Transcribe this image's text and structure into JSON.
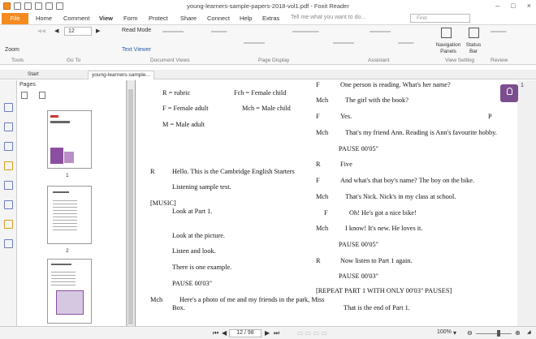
{
  "app": {
    "title": "young-learners-sample-papers-2018-vol1.pdf - Foxit Reader"
  },
  "menu": {
    "file": "File",
    "tabs": [
      "Home",
      "Comment",
      "View",
      "Form",
      "Protect",
      "Share",
      "Connect",
      "Help",
      "Extras"
    ],
    "tell_me": "Tell me what you want to do...",
    "find_placeholder": "Find"
  },
  "ribbon": {
    "zoom": "Zoom",
    "page_number": "12",
    "read_mode": "Read Mode",
    "text_viewer": "Text Viewer",
    "navigation_panels": "Navigation Panels",
    "status_bar": "Status Bar",
    "groups": [
      "Tools",
      "Go To",
      "Document Views",
      "Page Display",
      "Assistant",
      "View Setting",
      "Review"
    ]
  },
  "doc_tabs": {
    "start": "Start",
    "doc": "young-learners-sample..."
  },
  "pages_panel": {
    "title": "Pages",
    "thumbs": [
      "1",
      "2"
    ]
  },
  "document": {
    "left": [
      "R = rubric",
      "Fch = Female child",
      "F = Female adult",
      "Mch = Male child",
      "M = Male adult",
      "R",
      "Hello. This is the Cambridge English Starters",
      "Listening sample test.",
      "[MUSIC]",
      "Look at Part 1.",
      "Look at the picture.",
      "Listen and look.",
      "There is one example.",
      "PAUSE 00'03\"",
      "Mch",
      "Here's a photo of me and my friends in the park, Miss",
      "Box."
    ],
    "right": [
      "F",
      "One person is reading. What's her name?",
      "Mch",
      "The girl with the book?",
      "F",
      "Yes.",
      "P",
      "Mch",
      "That's my friend Ann. Reading is Ann's favourite hobby.",
      "PAUSE 00'05\"",
      "R",
      "Five",
      "F",
      "And what's that boy's name? The boy on the bike.",
      "Mch",
      "That's Nick. Nick's in my class at school.",
      "F",
      "Oh! He's got a nice bike!",
      "Mch",
      "I know! It's new. He loves it.",
      "PAUSE 00'05\"",
      "R",
      "Now listen to Part 1 again.",
      "PAUSE 00'03\"",
      "[REPEAT PART 1 WITH ONLY 00'03\" PAUSES]",
      "That is the end of Part 1."
    ]
  },
  "side_badge": {
    "number": "1"
  },
  "status": {
    "page_indicator": "12 / 98",
    "zoom": "100%"
  }
}
